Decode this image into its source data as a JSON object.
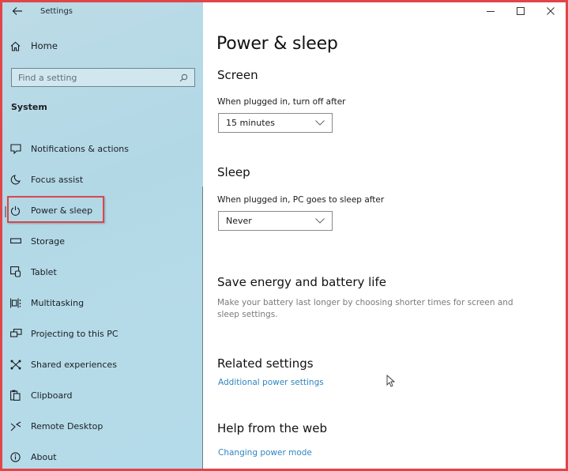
{
  "window": {
    "title": "Settings",
    "controls": {
      "minimize": "minimize-icon",
      "maximize": "maximize-icon",
      "close": "close-icon"
    }
  },
  "sidebar": {
    "home_label": "Home",
    "search_placeholder": "Find a setting",
    "section_heading": "System",
    "items": [
      {
        "label": "Notifications & actions",
        "icon": "notifications-icon"
      },
      {
        "label": "Focus assist",
        "icon": "moon-icon"
      },
      {
        "label": "Power & sleep",
        "icon": "power-icon",
        "selected": true
      },
      {
        "label": "Storage",
        "icon": "storage-icon"
      },
      {
        "label": "Tablet",
        "icon": "tablet-icon"
      },
      {
        "label": "Multitasking",
        "icon": "multitasking-icon"
      },
      {
        "label": "Projecting to this PC",
        "icon": "projecting-icon"
      },
      {
        "label": "Shared experiences",
        "icon": "shared-icon"
      },
      {
        "label": "Clipboard",
        "icon": "clipboard-icon"
      },
      {
        "label": "Remote Desktop",
        "icon": "remote-desktop-icon"
      },
      {
        "label": "About",
        "icon": "info-icon"
      }
    ]
  },
  "main": {
    "page_title": "Power & sleep",
    "screen": {
      "heading": "Screen",
      "label": "When plugged in, turn off after",
      "value": "15 minutes"
    },
    "sleep": {
      "heading": "Sleep",
      "label": "When plugged in, PC goes to sleep after",
      "value": "Never"
    },
    "save_energy": {
      "heading": "Save energy and battery life",
      "description": "Make your battery last longer by choosing shorter times for screen and sleep settings."
    },
    "related": {
      "heading": "Related settings",
      "link": "Additional power settings"
    },
    "help": {
      "heading": "Help from the web",
      "link": "Changing power mode"
    }
  },
  "colors": {
    "highlight_border": "#e0454a",
    "link": "#2f86c0",
    "sidebar_bg": "#b4dbe9"
  }
}
